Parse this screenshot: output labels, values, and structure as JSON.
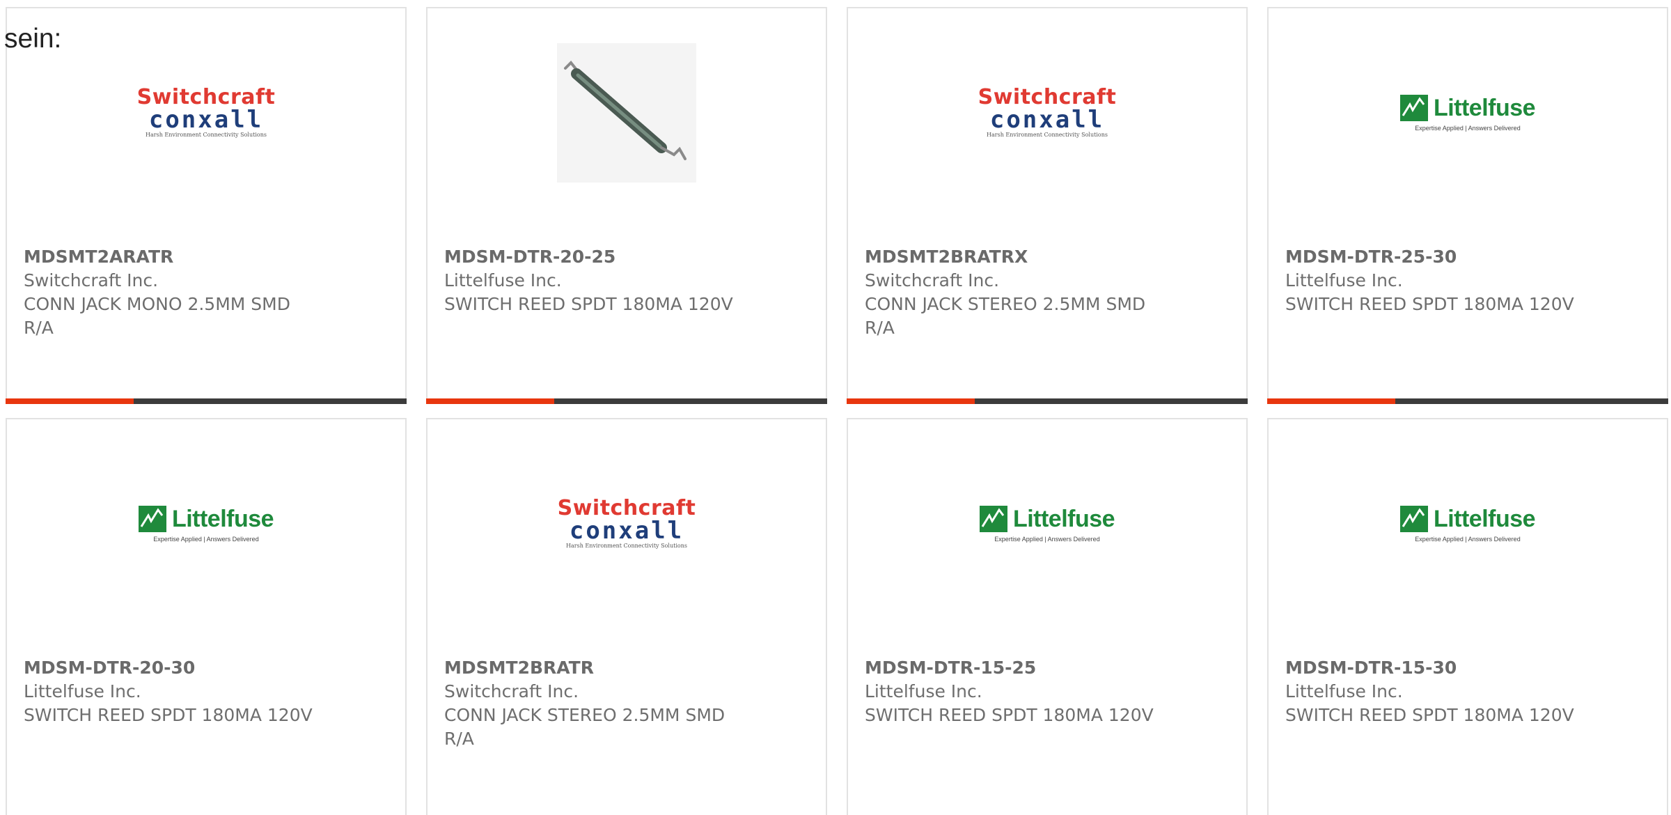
{
  "intro": "sein:",
  "colors": {
    "accent": "#e8360e",
    "progress_track": "#3c3c3c",
    "card_border": "#e2e2e2",
    "text": "#6e6e6e",
    "switchcraft_red": "#e03a32",
    "switchcraft_blue": "#1f3e7a",
    "littelfuse_green": "#1f8a3c"
  },
  "brand_logos": {
    "switchcraft": {
      "icon": "switchcraft-conxall-logo",
      "top": "Switchcraft",
      "bottom": "conxall",
      "tagline": "Harsh Environment Connectivity Solutions"
    },
    "littelfuse": {
      "icon": "littelfuse-logo",
      "name": "Littelfuse",
      "tagline": "Expertise Applied | Answers Delivered"
    }
  },
  "products": [
    {
      "part_number": "MDSMT2ARATR",
      "manufacturer": "Switchcraft Inc.",
      "description_line1": "CONN JACK MONO 2.5MM SMD",
      "description_line2": "R/A",
      "image": "switchcraft-conxall-logo",
      "progress_fraction": 0.32
    },
    {
      "part_number": "MDSM-DTR-20-25",
      "manufacturer": "Littelfuse Inc.",
      "description_line1": "SWITCH REED SPDT 180MA 120V",
      "description_line2": "",
      "image": "reed-switch-photo",
      "progress_fraction": 0.32
    },
    {
      "part_number": "MDSMT2BRATRX",
      "manufacturer": "Switchcraft Inc.",
      "description_line1": "CONN JACK STEREO 2.5MM SMD",
      "description_line2": "R/A",
      "image": "switchcraft-conxall-logo",
      "progress_fraction": 0.32
    },
    {
      "part_number": "MDSM-DTR-25-30",
      "manufacturer": "Littelfuse Inc.",
      "description_line1": "SWITCH REED SPDT 180MA 120V",
      "description_line2": "",
      "image": "littelfuse-logo",
      "progress_fraction": 0.32
    },
    {
      "part_number": "MDSM-DTR-20-30",
      "manufacturer": "Littelfuse Inc.",
      "description_line1": "SWITCH REED SPDT 180MA 120V",
      "description_line2": "",
      "image": "littelfuse-logo",
      "progress_fraction": null
    },
    {
      "part_number": "MDSMT2BRATR",
      "manufacturer": "Switchcraft Inc.",
      "description_line1": "CONN JACK STEREO 2.5MM SMD",
      "description_line2": "R/A",
      "image": "switchcraft-conxall-logo",
      "progress_fraction": null
    },
    {
      "part_number": "MDSM-DTR-15-25",
      "manufacturer": "Littelfuse Inc.",
      "description_line1": "SWITCH REED SPDT 180MA 120V",
      "description_line2": "",
      "image": "littelfuse-logo",
      "progress_fraction": null
    },
    {
      "part_number": "MDSM-DTR-15-30",
      "manufacturer": "Littelfuse Inc.",
      "description_line1": "SWITCH REED SPDT 180MA 120V",
      "description_line2": "",
      "image": "littelfuse-logo",
      "progress_fraction": null
    }
  ]
}
